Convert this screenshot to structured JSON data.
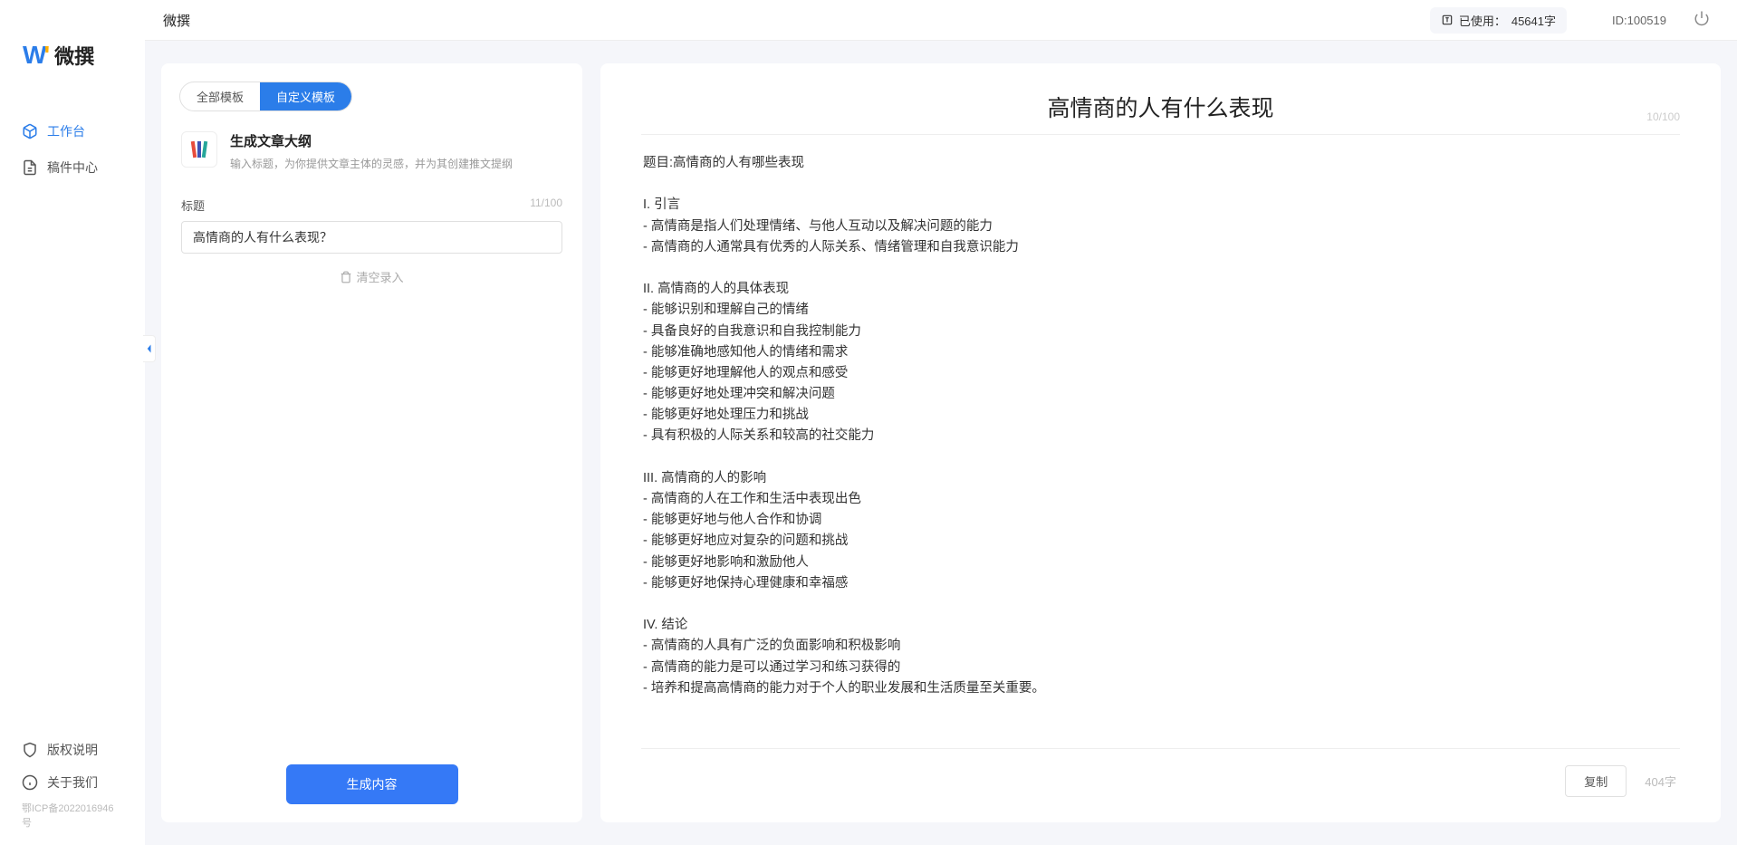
{
  "app": {
    "name": "微撰",
    "logo_text": "微撰"
  },
  "sidebar": {
    "nav": [
      {
        "label": "工作台",
        "icon": "cube-icon",
        "active": true
      },
      {
        "label": "稿件中心",
        "icon": "document-icon",
        "active": false
      }
    ],
    "footer": [
      {
        "label": "版权说明",
        "icon": "shield-icon"
      },
      {
        "label": "关于我们",
        "icon": "info-icon"
      }
    ],
    "icp": "鄂ICP备2022016946号"
  },
  "topbar": {
    "title": "微撰",
    "usage_prefix": "已使用：",
    "usage_value": "45641字",
    "user_id": "ID:100519"
  },
  "left_panel": {
    "tabs": [
      {
        "label": "全部模板",
        "active": false
      },
      {
        "label": "自定义模板",
        "active": true
      }
    ],
    "template": {
      "title": "生成文章大纲",
      "desc": "输入标题，为你提供文章主体的灵感，并为其创建推文提纲"
    },
    "form": {
      "label": "标题",
      "char_count": "11/100",
      "value": "高情商的人有什么表现？",
      "clear_label": "清空录入"
    },
    "generate_label": "生成内容"
  },
  "right_panel": {
    "title": "高情商的人有什么表现",
    "title_count": "10/100",
    "body": "题目:高情商的人有哪些表现\n\nI. 引言\n- 高情商是指人们处理情绪、与他人互动以及解决问题的能力\n- 高情商的人通常具有优秀的人际关系、情绪管理和自我意识能力\n\nII. 高情商的人的具体表现\n- 能够识别和理解自己的情绪\n- 具备良好的自我意识和自我控制能力\n- 能够准确地感知他人的情绪和需求\n- 能够更好地理解他人的观点和感受\n- 能够更好地处理冲突和解决问题\n- 能够更好地处理压力和挑战\n- 具有积极的人际关系和较高的社交能力\n\nIII. 高情商的人的影响\n- 高情商的人在工作和生活中表现出色\n- 能够更好地与他人合作和协调\n- 能够更好地应对复杂的问题和挑战\n- 能够更好地影响和激励他人\n- 能够更好地保持心理健康和幸福感\n\nIV. 结论\n- 高情商的人具有广泛的负面影响和积极影响\n- 高情商的能力是可以通过学习和练习获得的\n- 培养和提高高情商的能力对于个人的职业发展和生活质量至关重要。",
    "copy_label": "复制",
    "word_count": "404字"
  }
}
